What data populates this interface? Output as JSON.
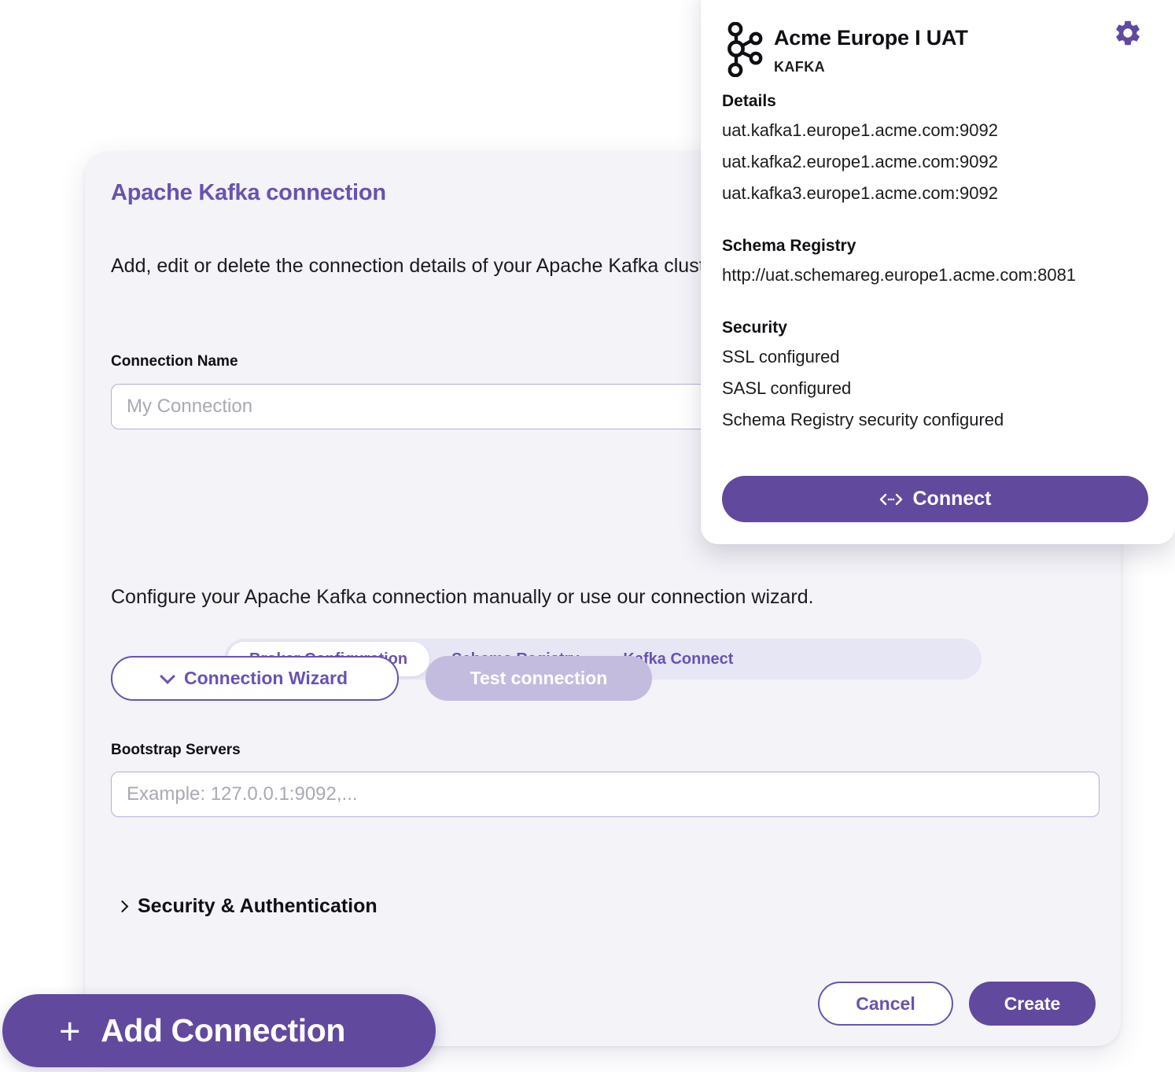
{
  "dialog": {
    "title": "Apache Kafka connection",
    "description": "Add, edit or delete the connection details of your Apache Kafka cluster",
    "connection_name": {
      "label": "Connection Name",
      "placeholder": "My Connection",
      "value": ""
    },
    "tabs": [
      {
        "label": "Broker Configuration",
        "active": true
      },
      {
        "label": "Schema Registry",
        "active": false
      },
      {
        "label": "Kafka Connect",
        "active": false
      }
    ],
    "body_note": "Configure your Apache Kafka connection manually or use our connection wizard.",
    "wizard_button": "Connection Wizard",
    "test_button": "Test connection",
    "bootstrap_servers": {
      "label": "Bootstrap Servers",
      "placeholder": "Example: 127.0.0.1:9092,...",
      "value": ""
    },
    "security_auth_label": "Security & Authentication",
    "cancel_label": "Cancel",
    "create_label": "Create"
  },
  "popup": {
    "title": "Acme Europe I UAT",
    "subtitle": "KAFKA",
    "details_heading": "Details",
    "details_lines": [
      "uat.kafka1.europe1.acme.com:9092",
      "uat.kafka2.europe1.acme.com:9092",
      "uat.kafka3.europe1.acme.com:9092"
    ],
    "schema_registry_heading": "Schema Registry",
    "schema_registry_url": "http://uat.schemareg.europe1.acme.com:8081",
    "security_heading": "Security",
    "security_lines": [
      "SSL configured",
      "SASL configured",
      "Schema Registry security configured"
    ],
    "connect_label": "Connect"
  },
  "fab": {
    "label": "Add Connection",
    "plus": "+"
  },
  "colors": {
    "brand_purple": "#61499e",
    "title_purple": "#6a52b0",
    "dialog_bg": "#f3f3f8",
    "tabbar_bg": "#e6e6f4",
    "disabled_btn": "#c4bcdf",
    "input_border": "#b3aee0"
  }
}
